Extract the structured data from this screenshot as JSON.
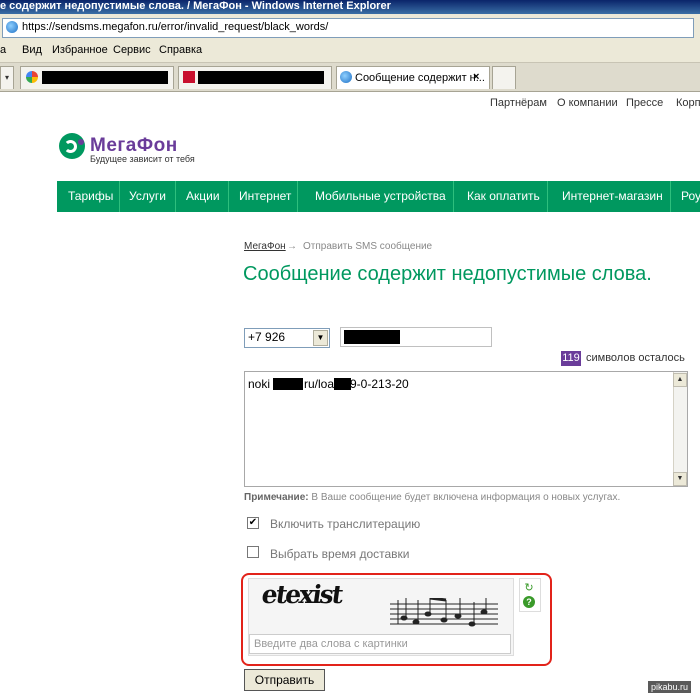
{
  "window": {
    "title": "е содержит недопустимые слова. / МегаФон - Windows Internet Explorer",
    "address": "https://sendsms.megafon.ru/error/invalid_request/black_words/"
  },
  "menu": [
    "а",
    "Вид",
    "Избранное",
    "Сервис",
    "Справка"
  ],
  "tabs": {
    "active_label": "Сообщение содержит н...",
    "close_glyph": "×"
  },
  "topnav": [
    "Партнёрам",
    "О компании",
    "Прессе",
    "Корп"
  ],
  "logo": {
    "name": "МегаФон",
    "tagline": "Будущее зависит от тебя"
  },
  "mainnav": [
    "Тарифы",
    "Услуги",
    "Акции",
    "Интернет",
    "Мобильные устройства",
    "Как оплатить",
    "Интернет-магазин",
    "Роу"
  ],
  "breadcrumb": {
    "home": "МегаФон",
    "arrow": "→",
    "current": "Отправить SMS сообщение"
  },
  "page_title": "Сообщение содержит недопустимые слова.",
  "form": {
    "prefix_value": "+7 926",
    "counter_value": "119",
    "counter_label": "символов осталось",
    "message_start": "noki",
    "message_mid": "ru/loa",
    "message_end": "9-0-213-20",
    "note_label": "Примечание:",
    "note_text": "В Ваше сообщение будет включена информация о новых услугах.",
    "translit_label": "Включить транслитерацию",
    "translit_checked": "✔",
    "delivery_label": "Выбрать время доставки",
    "captcha_placeholder": "Введите два слова с картинки",
    "captcha_word1": "etexist",
    "submit_label": "Отправить"
  },
  "watermark": "pikabu.ru",
  "colors": {
    "brand_green": "#00985f",
    "brand_purple": "#6a3c9a",
    "highlight_red": "#e2231a"
  }
}
